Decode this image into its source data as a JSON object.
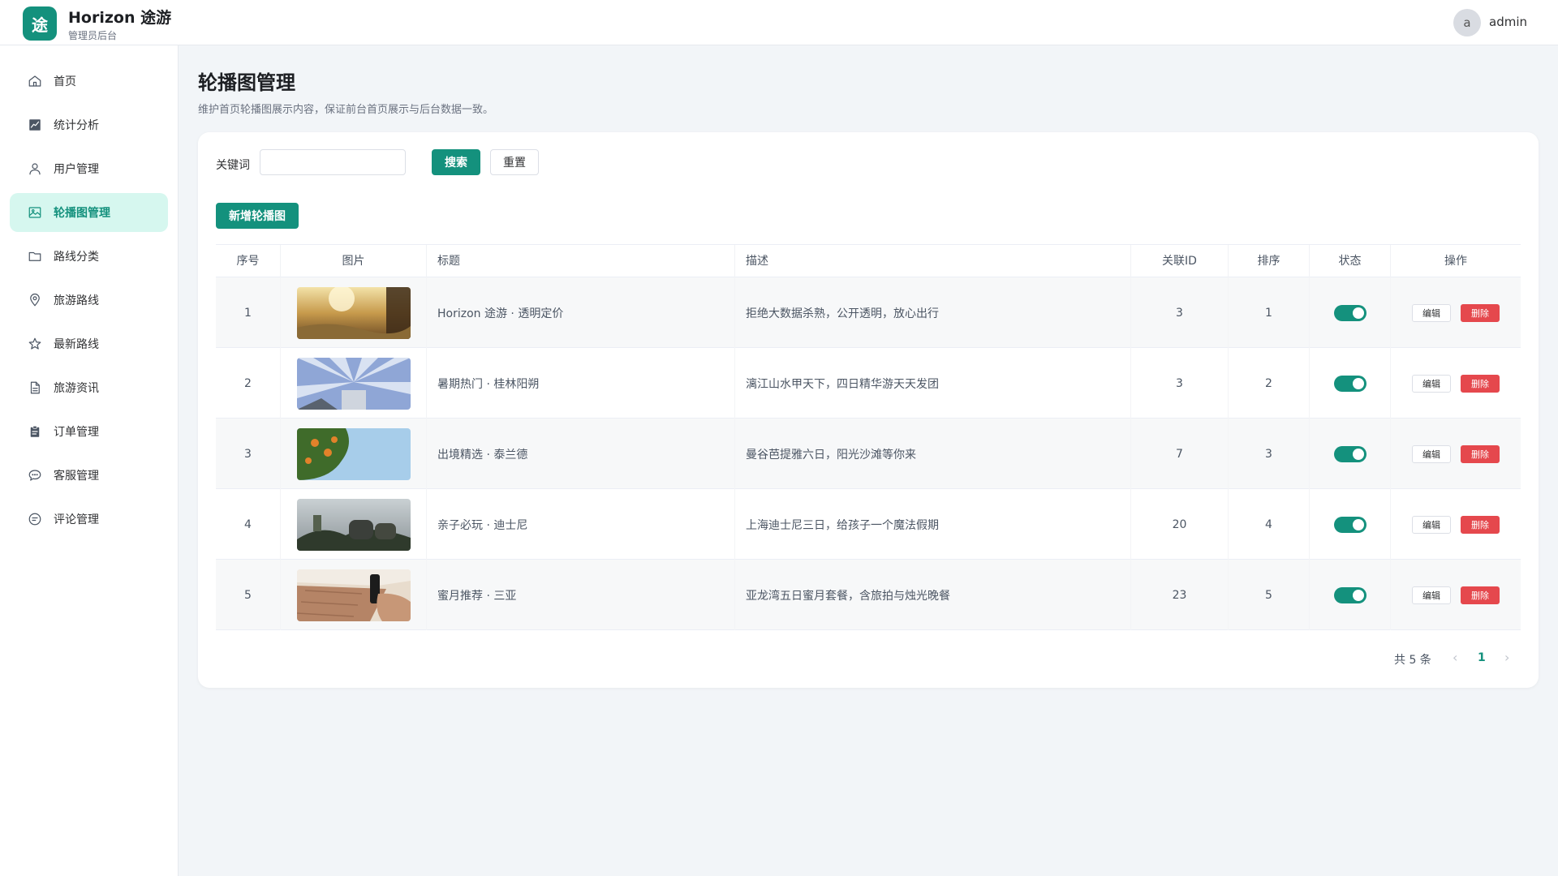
{
  "brand": {
    "logo_char": "途",
    "name": "Horizon 途游",
    "subtitle": "管理员后台"
  },
  "user": {
    "avatar_char": "a",
    "name": "admin"
  },
  "sidebar": {
    "items": [
      {
        "label": "首页",
        "icon": "home-icon",
        "active": false
      },
      {
        "label": "统计分析",
        "icon": "chart-icon",
        "active": false
      },
      {
        "label": "用户管理",
        "icon": "user-icon",
        "active": false
      },
      {
        "label": "轮播图管理",
        "icon": "image-icon",
        "active": true
      },
      {
        "label": "路线分类",
        "icon": "folder-icon",
        "active": false
      },
      {
        "label": "旅游路线",
        "icon": "map-pin-icon",
        "active": false
      },
      {
        "label": "最新路线",
        "icon": "star-icon",
        "active": false
      },
      {
        "label": "旅游资讯",
        "icon": "document-icon",
        "active": false
      },
      {
        "label": "订单管理",
        "icon": "clipboard-icon",
        "active": false
      },
      {
        "label": "客服管理",
        "icon": "chat-icon",
        "active": false
      },
      {
        "label": "评论管理",
        "icon": "comment-icon",
        "active": false
      }
    ]
  },
  "page": {
    "title": "轮播图管理",
    "description": "维护首页轮播图展示内容，保证前台首页展示与后台数据一致。"
  },
  "search": {
    "keyword_label": "关键词",
    "keyword_value": "",
    "keyword_placeholder": "",
    "search_button": "搜索",
    "reset_button": "重置",
    "add_button": "新增轮播图"
  },
  "table": {
    "columns": [
      "序号",
      "图片",
      "标题",
      "描述",
      "关联ID",
      "排序",
      "状态",
      "操作"
    ],
    "edit_label": "编辑",
    "delete_label": "删除",
    "rows": [
      {
        "index": "1",
        "title": "Horizon 途游 · 透明定价",
        "description": "拒绝大数据杀熟，公开透明，放心出行",
        "related_id": "3",
        "sort": "1",
        "enabled": true
      },
      {
        "index": "2",
        "title": "暑期热门 · 桂林阳朔",
        "description": "漓江山水甲天下，四日精华游天天发团",
        "related_id": "3",
        "sort": "2",
        "enabled": true
      },
      {
        "index": "3",
        "title": "出境精选 · 泰兰德",
        "description": "曼谷芭提雅六日，阳光沙滩等你来",
        "related_id": "7",
        "sort": "3",
        "enabled": true
      },
      {
        "index": "4",
        "title": "亲子必玩 · 迪士尼",
        "description": "上海迪士尼三日，给孩子一个魔法假期",
        "related_id": "20",
        "sort": "4",
        "enabled": true
      },
      {
        "index": "5",
        "title": "蜜月推荐 · 三亚",
        "description": "亚龙湾五日蜜月套餐，含旅拍与烛光晚餐",
        "related_id": "23",
        "sort": "5",
        "enabled": true
      }
    ]
  },
  "pagination": {
    "total_text": "共 5 条",
    "current_page": "1",
    "prev_icon": "chevron-left-icon",
    "next_icon": "chevron-right-icon"
  },
  "colors": {
    "primary": "#14917d",
    "active_bg": "#d6f7ef",
    "danger": "#e5484d",
    "page_bg": "#f2f5f8"
  }
}
